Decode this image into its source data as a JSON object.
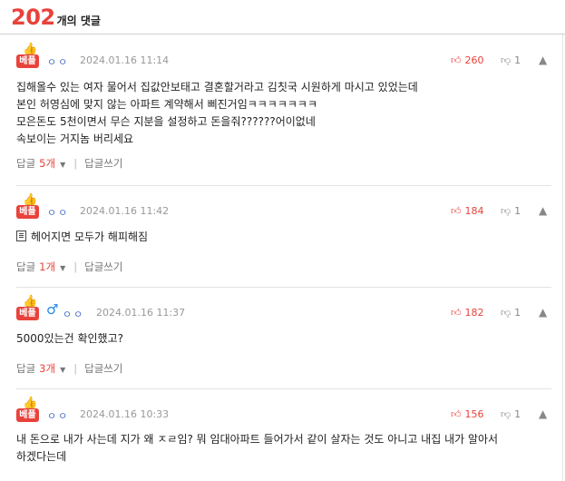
{
  "header": {
    "count": "202",
    "count_label": "개의 댓글"
  },
  "colors": {
    "accent": "#e8423b",
    "nickname": "#4a70c8",
    "gender_icon": "#1e88e5"
  },
  "comments": [
    {
      "badge": "베플",
      "nickname": "ㅇㅇ",
      "date": "2024.01.16 11:14",
      "likes": "260",
      "dislikes": "1",
      "text": "집해올수 있는 여자 물어서 집값안보태고 결혼할거라고 김칫국 시원하게 마시고 있었는데\n본인 허영심에 맞지 않는 아파트 계약해서 삐진거임ㅋㅋㅋㅋㅋㅋㅋ\n모은돈도 5천이면서 무슨 지분을 설정하고 돈을줘??????어이없네\n속보이는 거지놈 버리세요",
      "reply_label": "답글",
      "reply_count": "5개",
      "write_reply": "답글쓰기"
    },
    {
      "badge": "베플",
      "nickname": "ㅇㅇ",
      "date": "2024.01.16 11:42",
      "likes": "184",
      "dislikes": "1",
      "text": "헤어지면 모두가 해피해짐",
      "reply_label": "답글",
      "reply_count": "1개",
      "write_reply": "답글쓰기"
    },
    {
      "badge": "베플",
      "nickname": "ㅇㅇ",
      "gender_icon": "male-icon",
      "date": "2024.01.16 11:37",
      "likes": "182",
      "dislikes": "1",
      "text": "5000있는건 확인했고?",
      "reply_label": "답글",
      "reply_count": "3개",
      "write_reply": "답글쓰기"
    },
    {
      "badge": "베플",
      "nickname": "ㅇㅇ",
      "date": "2024.01.16 10:33",
      "likes": "156",
      "dislikes": "1",
      "text": "내 돈으로 내가 사는데 지가 왜 ㅈㄹ임? 뭐 임대아파트 들어가서 같이 살자는 것도 아니고 내집 내가 알아서\n하겠다는데"
    }
  ]
}
